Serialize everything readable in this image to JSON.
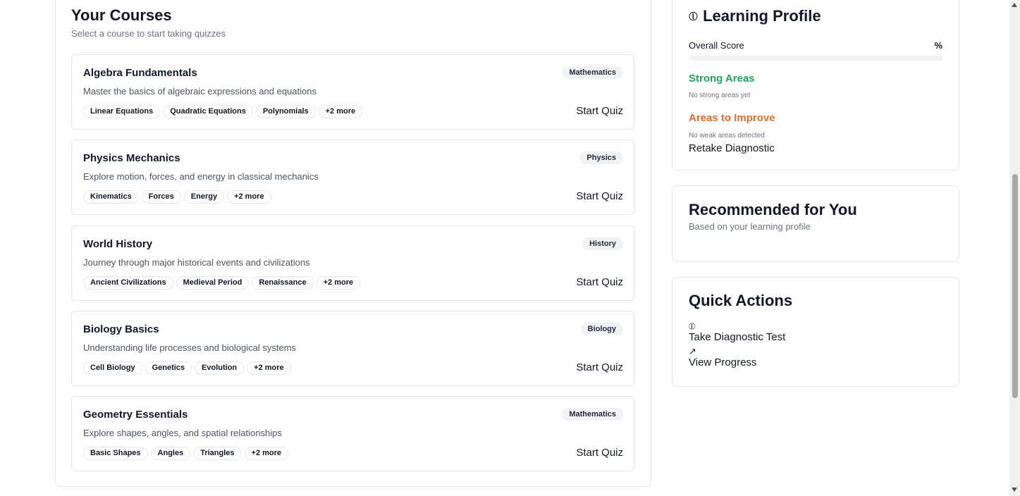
{
  "courses_section": {
    "title": "Your Courses",
    "subtitle": "Select a course to start taking quizzes",
    "start_label": "Start Quiz",
    "items": [
      {
        "title": "Algebra Fundamentals",
        "category": "Mathematics",
        "description": "Master the basics of algebraic expressions and equations",
        "topics": [
          "Linear Equations",
          "Quadratic Equations",
          "Polynomials"
        ],
        "more": "+2 more"
      },
      {
        "title": "Physics Mechanics",
        "category": "Physics",
        "description": "Explore motion, forces, and energy in classical mechanics",
        "topics": [
          "Kinematics",
          "Forces",
          "Energy"
        ],
        "more": "+2 more"
      },
      {
        "title": "World History",
        "category": "History",
        "description": "Journey through major historical events and civilizations",
        "topics": [
          "Ancient Civilizations",
          "Medieval Period",
          "Renaissance"
        ],
        "more": "+2 more"
      },
      {
        "title": "Biology Basics",
        "category": "Biology",
        "description": "Understanding life processes and biological systems",
        "topics": [
          "Cell Biology",
          "Genetics",
          "Evolution"
        ],
        "more": "+2 more"
      },
      {
        "title": "Geometry Essentials",
        "category": "Mathematics",
        "description": "Explore shapes, angles, and spatial relationships",
        "topics": [
          "Basic Shapes",
          "Angles",
          "Triangles"
        ],
        "more": "+2 more"
      }
    ]
  },
  "learning_profile": {
    "icon": "brain-icon",
    "icon_glyph": "⦶",
    "title": "Learning Profile",
    "overall_score_label": "Overall Score",
    "overall_score_value": "%",
    "overall_score_fraction": 0,
    "strong_areas_title": "Strong Areas",
    "strong_areas_empty": "No strong areas yet",
    "improve_title": "Areas to Improve",
    "improve_empty": "No weak areas detected",
    "retake_label": "Retake Diagnostic",
    "colors": {
      "strong": "#22a559",
      "improve": "#ea6b27"
    }
  },
  "recommended": {
    "title": "Recommended for You",
    "subtitle": "Based on your learning profile"
  },
  "quick_actions": {
    "title": "Quick Actions",
    "items": [
      {
        "icon": "brain-icon",
        "icon_glyph": "⦶",
        "label": "Take Diagnostic Test"
      },
      {
        "icon": "trending-up-icon",
        "icon_glyph": "↗",
        "label": "View Progress"
      }
    ]
  }
}
